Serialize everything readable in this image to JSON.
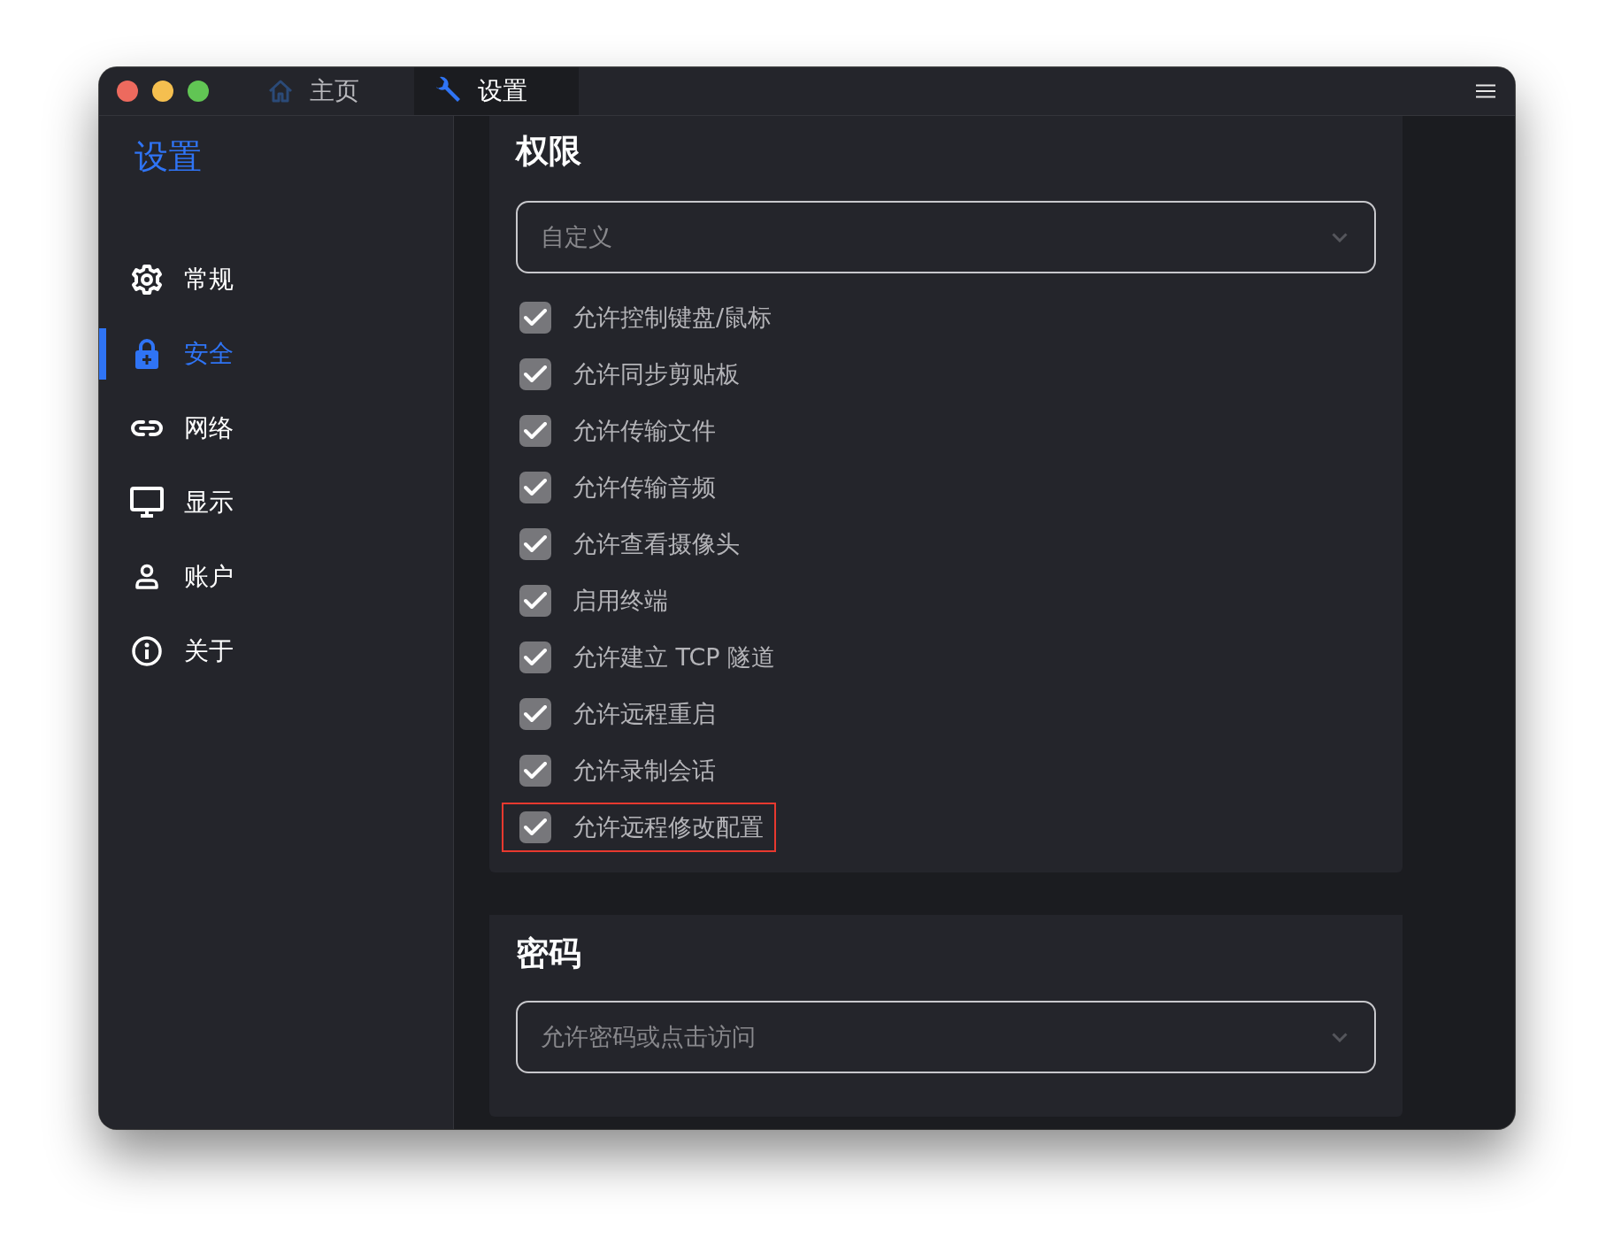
{
  "tabs": [
    {
      "kind": "home",
      "label": "主页",
      "selected": false
    },
    {
      "kind": "settings",
      "label": "设置",
      "selected": true
    }
  ],
  "sidebar": {
    "title": "设置",
    "items": [
      {
        "kind": "general",
        "label": "常规",
        "selected": false
      },
      {
        "kind": "security",
        "label": "安全",
        "selected": true
      },
      {
        "kind": "network",
        "label": "网络",
        "selected": false
      },
      {
        "kind": "display",
        "label": "显示",
        "selected": false
      },
      {
        "kind": "account",
        "label": "账户",
        "selected": false
      },
      {
        "kind": "about",
        "label": "关于",
        "selected": false
      }
    ]
  },
  "sections": [
    {
      "title": "权限",
      "dropdown": {
        "value": "自定义"
      },
      "options": [
        {
          "label": "允许控制键盘/鼠标",
          "checked": true,
          "highlighted": false
        },
        {
          "label": "允许同步剪贴板",
          "checked": true,
          "highlighted": false
        },
        {
          "label": "允许传输文件",
          "checked": true,
          "highlighted": false
        },
        {
          "label": "允许传输音频",
          "checked": true,
          "highlighted": false
        },
        {
          "label": "允许查看摄像头",
          "checked": true,
          "highlighted": false
        },
        {
          "label": "启用终端",
          "checked": true,
          "highlighted": false
        },
        {
          "label": "允许建立 TCP 隧道",
          "checked": true,
          "highlighted": false
        },
        {
          "label": "允许远程重启",
          "checked": true,
          "highlighted": false
        },
        {
          "label": "允许录制会话",
          "checked": true,
          "highlighted": false
        },
        {
          "label": "允许远程修改配置",
          "checked": true,
          "highlighted": true
        }
      ]
    },
    {
      "title": "密码",
      "dropdown": {
        "value": "允许密码或点击访问"
      }
    }
  ]
}
